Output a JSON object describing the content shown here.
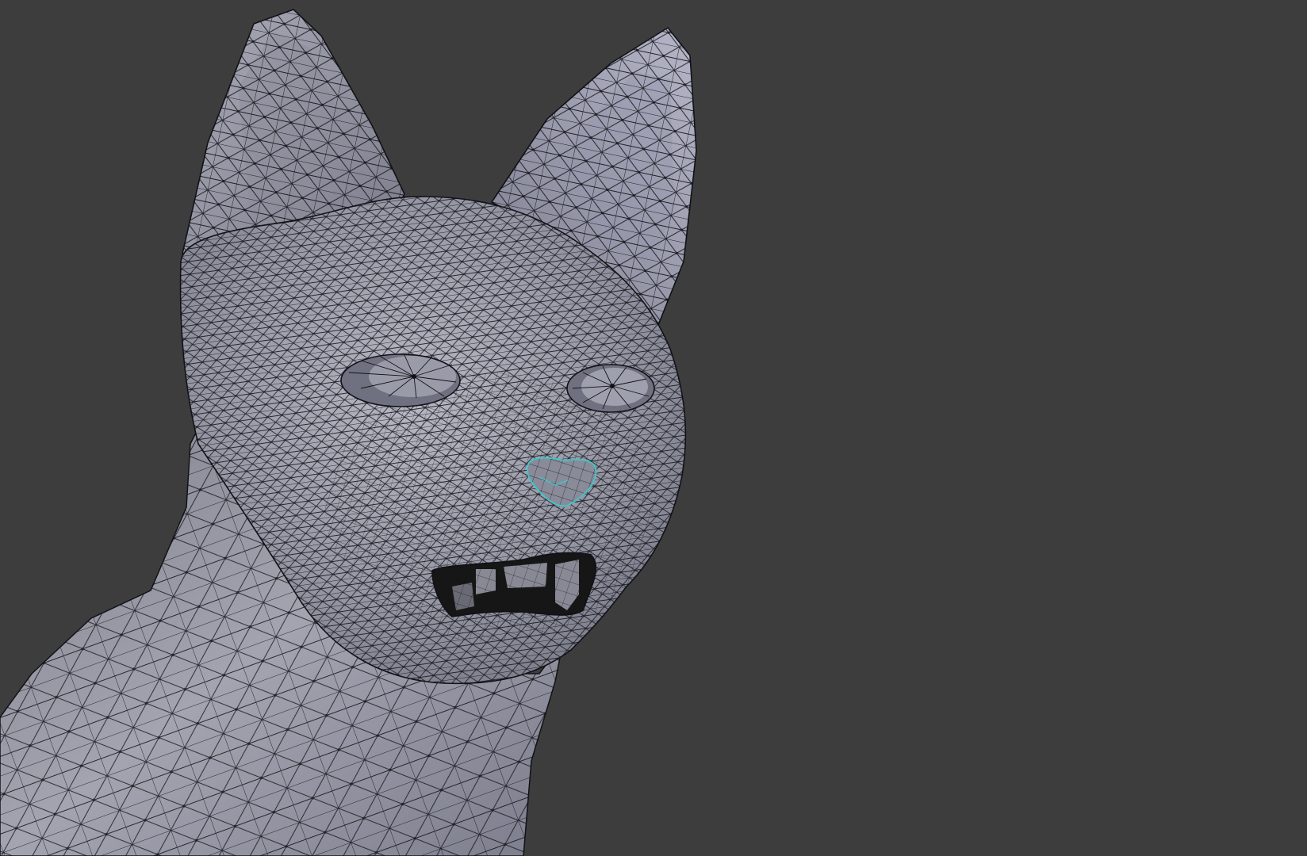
{
  "viewport": {
    "background": "#3d3d3d",
    "mode": "edit-mode-wireframe-overlay",
    "object": "cat-head-mesh",
    "mesh_fill": "#8f909c",
    "mesh_highlight": "#c4c5d0",
    "mesh_shadow": "#5f6070",
    "wire_color": "#0f0f12",
    "selection_color": "#3fc7c9",
    "mouth_interior_color": "#161616"
  }
}
